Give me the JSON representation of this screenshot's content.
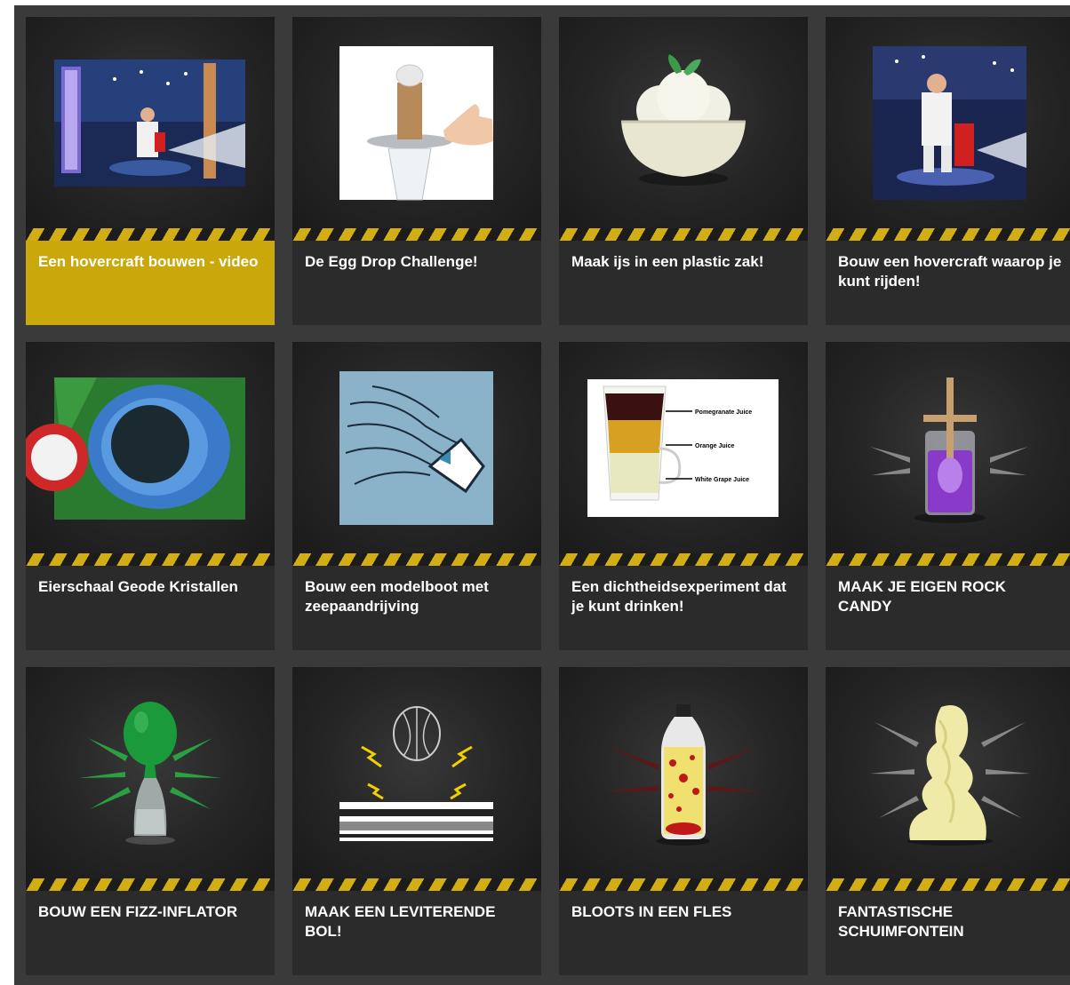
{
  "grid": {
    "cards": [
      {
        "title": "Een hovercraft bouwen - video",
        "thumbnail": "talk-show-hovercraft-photo",
        "active": true
      },
      {
        "title": "De Egg Drop Challenge!",
        "thumbnail": "egg-drop-photo",
        "active": false
      },
      {
        "title": "Maak ijs in een plastic zak!",
        "thumbnail": "ice-cream-bowl-icon",
        "active": false
      },
      {
        "title": "Bouw een hovercraft waarop je kunt rijden!",
        "thumbnail": "talk-show-hovercraft-photo-2",
        "active": false
      },
      {
        "title": "Eierschaal Geode Kristallen",
        "thumbnail": "eggshell-geode-photo",
        "active": false
      },
      {
        "title": "Bouw een modelboot met zeepaandrijving",
        "thumbnail": "soap-boat-drawing",
        "active": false
      },
      {
        "title": "Een dichtheidsexperiment dat je kunt drinken!",
        "thumbnail": "density-drink-photo",
        "active": false
      },
      {
        "title": "MAAK JE EIGEN ROCK CANDY",
        "thumbnail": "rock-candy-jar-icon",
        "active": false
      },
      {
        "title": "BOUW EEN FIZZ-INFLATOR",
        "thumbnail": "fizz-inflator-balloon-icon",
        "active": false
      },
      {
        "title": "MAAK EEN LEVITERENDE BOL!",
        "thumbnail": "levitating-orb-icon",
        "active": false
      },
      {
        "title": "BLOOTS IN EEN FLES",
        "thumbnail": "lava-bottle-icon",
        "active": false
      },
      {
        "title": "FANTASTISCHE SCHUIMFONTEIN",
        "thumbnail": "foam-fountain-icon",
        "active": false
      }
    ]
  },
  "density_labels": [
    "Pomegranate Juice",
    "Orange Juice",
    "White Grape Juice"
  ],
  "colors": {
    "board_bg": "#3a3a3a",
    "card_bg": "#1e1e1e",
    "caption_bg": "#2b2b2b",
    "caption_active_bg": "#caa80c",
    "hazard_yellow": "#d2ae14",
    "title_text": "#ffffff"
  }
}
